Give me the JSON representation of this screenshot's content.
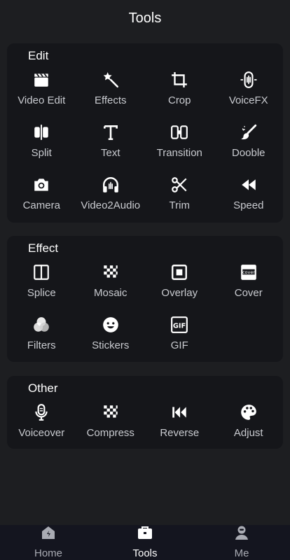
{
  "header": {
    "title": "Tools"
  },
  "sections": {
    "edit": {
      "title": "Edit",
      "items": [
        "Video Edit",
        "Effects",
        "Crop",
        "VoiceFX",
        "Split",
        "Text",
        "Transition",
        "Dooble",
        "Camera",
        "Video2Audio",
        "Trim",
        "Speed"
      ]
    },
    "effect": {
      "title": "Effect",
      "items": [
        "Splice",
        "Mosaic",
        "Overlay",
        "Cover",
        "Filters",
        "Stickers",
        "GIF"
      ]
    },
    "other": {
      "title": "Other",
      "items": [
        "Voiceover",
        "Compress",
        "Reverse",
        "Adjust"
      ]
    }
  },
  "tabbar": {
    "home": "Home",
    "tools": "Tools",
    "me": "Me",
    "active": "Tools"
  },
  "icon_names": {
    "edit": [
      "clapperboard-icon",
      "magic-wand-icon",
      "crop-icon",
      "voice-fx-icon",
      "split-icon",
      "text-icon",
      "transition-icon",
      "brush-icon",
      "camera-icon",
      "headphones-icon",
      "scissors-icon",
      "rewind-icon"
    ],
    "effect": [
      "splice-icon",
      "mosaic-icon",
      "overlay-icon",
      "cover-icon",
      "filters-icon",
      "sticker-icon",
      "gif-icon"
    ],
    "other": [
      "microphone-icon",
      "compress-icon",
      "skip-back-icon",
      "palette-icon"
    ]
  },
  "colors": {
    "background": "#1d1e21",
    "card": "#15161a",
    "icon": "#ffffff",
    "label": "#c9cbd0",
    "tabbar": "#14151f"
  }
}
